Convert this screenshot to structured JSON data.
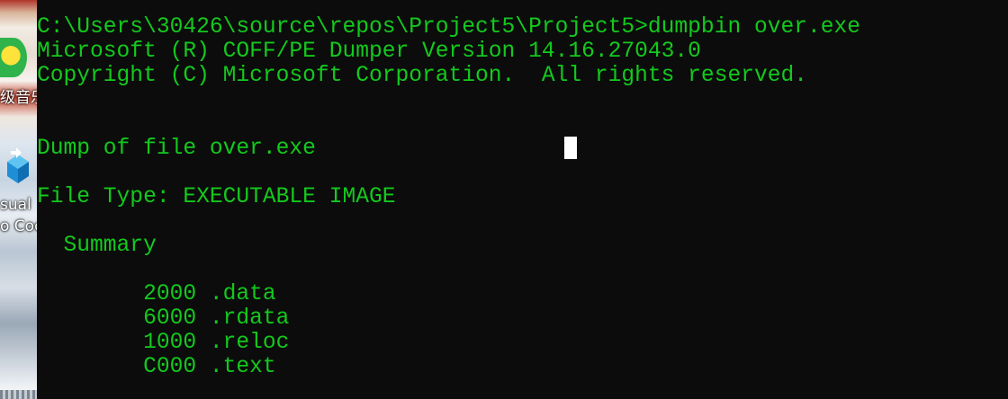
{
  "desktop": {
    "icon1_label": "级音乐",
    "icon2_label_line1": "sual",
    "icon2_label_line2": "o Coc"
  },
  "console": {
    "text_color": "#13c91d",
    "background": "#0c0c0c",
    "lines": [
      "C:\\Users\\30426\\source\\repos\\Project5\\Project5>dumpbin over.exe",
      "Microsoft (R) COFF/PE Dumper Version 14.16.27043.0",
      "Copyright (C) Microsoft Corporation.  All rights reserved.",
      "",
      "",
      "Dump of file over.exe",
      "",
      "File Type: EXECUTABLE IMAGE",
      "",
      "  Summary",
      "",
      "        2000 .data",
      "        6000 .rdata",
      "        1000 .reloc",
      "        C000 .text"
    ]
  }
}
